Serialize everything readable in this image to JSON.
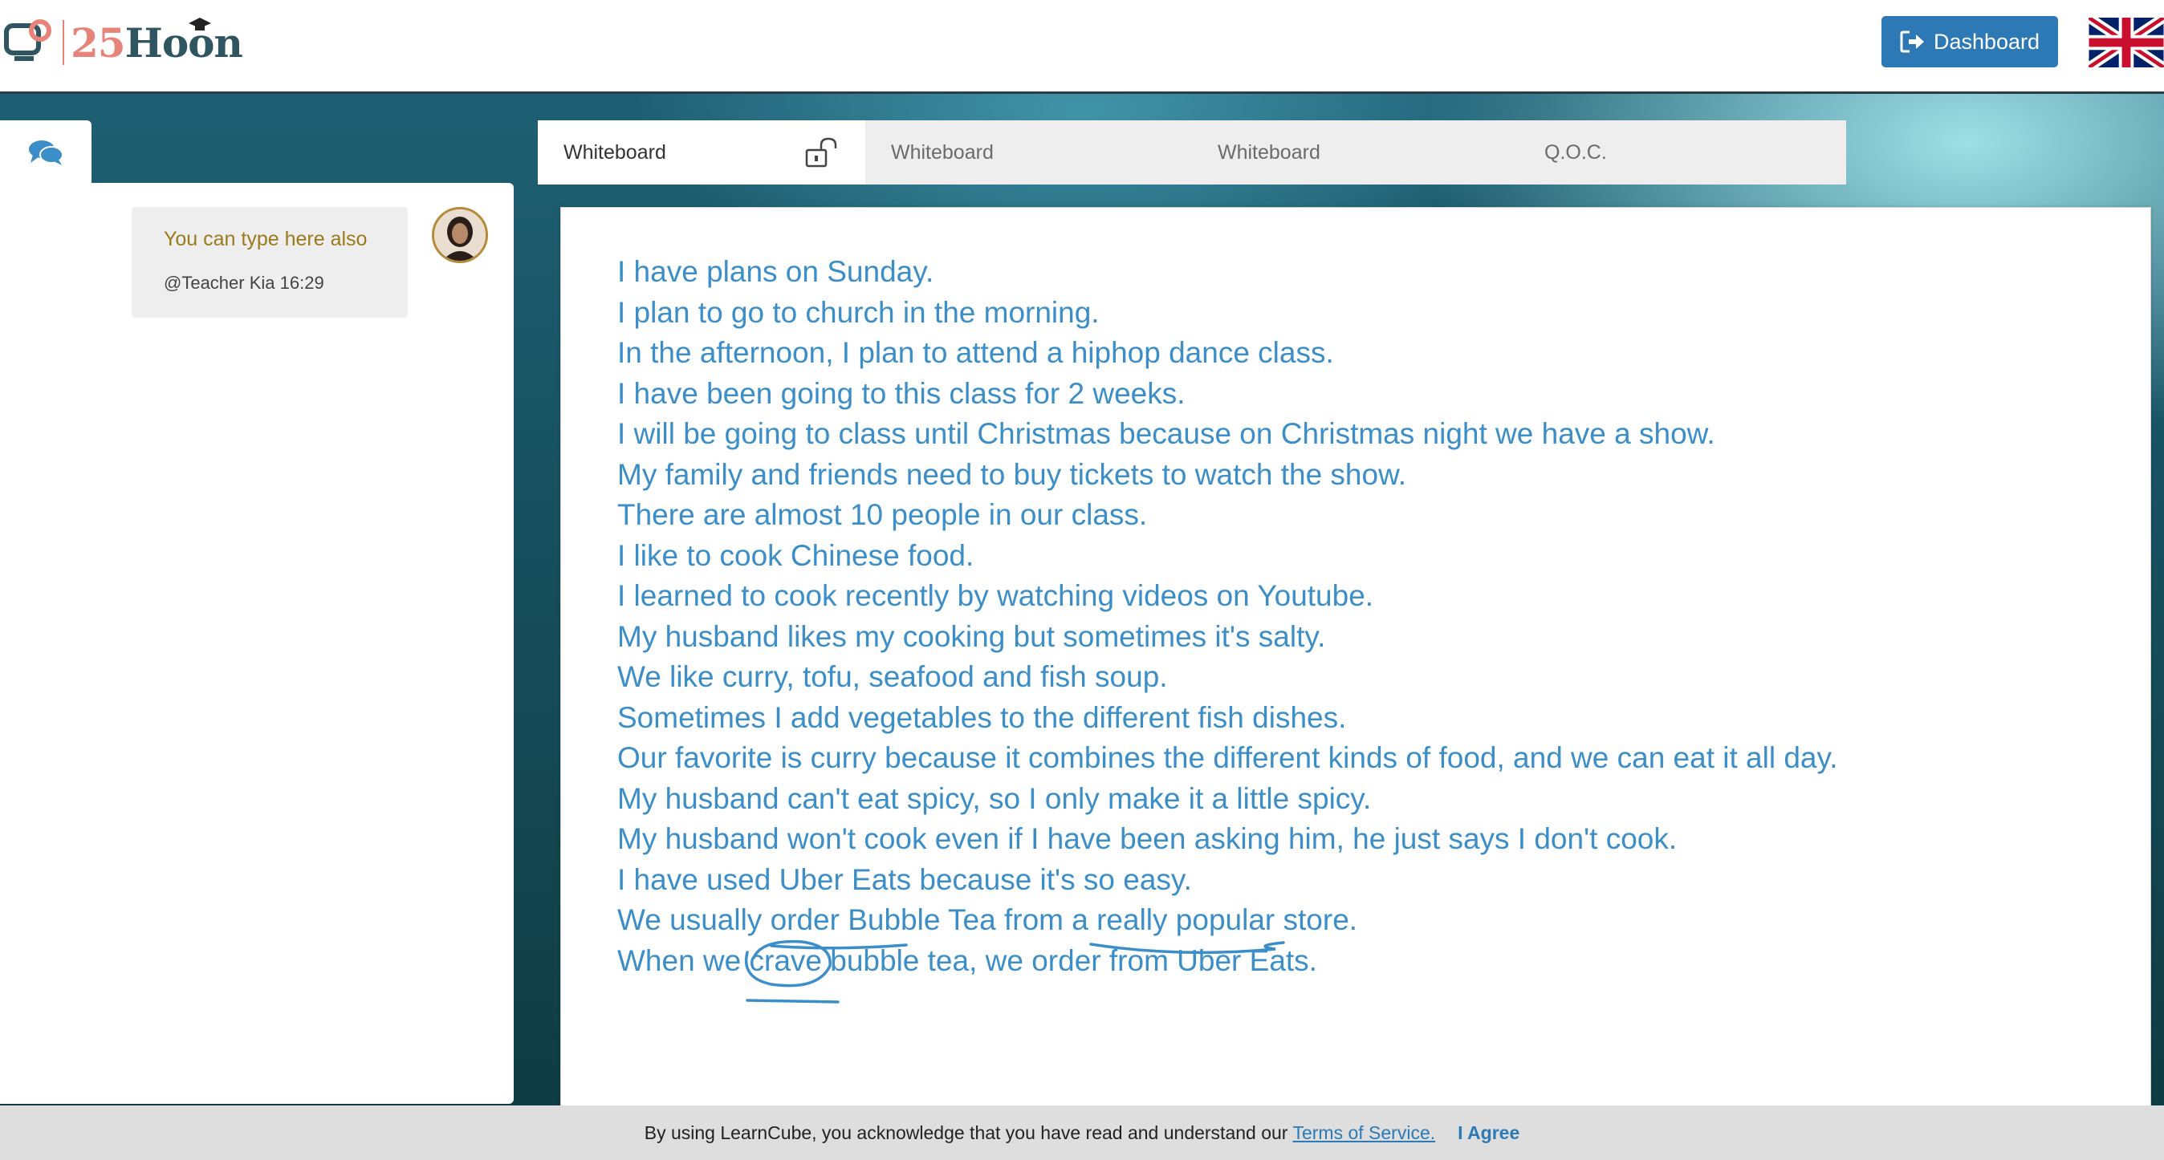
{
  "header": {
    "logo_number": "25",
    "logo_word": "Hoon",
    "dashboard_label": "Dashboard",
    "language": "English (UK flag)"
  },
  "chat": {
    "messages": [
      {
        "text": "You can type here also",
        "meta": "@Teacher Kia 16:29"
      }
    ]
  },
  "tabs": [
    {
      "label": "Whiteboard",
      "active": true,
      "locked": false
    },
    {
      "label": "Whiteboard",
      "active": false
    },
    {
      "label": "Whiteboard",
      "active": false
    },
    {
      "label": "Q.O.C.",
      "active": false
    }
  ],
  "whiteboard": {
    "ink_color": "#3b8ec8",
    "lines": [
      "I have plans on Sunday.",
      "I plan to go to church in the morning.",
      "In the afternoon, I plan to attend a hiphop dance class.",
      "I have been going to this class for 2 weeks.",
      "I will be going to class until Christmas because on Christmas night we have a show.",
      "My family and friends need to buy tickets to watch the show.",
      "There are almost 10 people in our class.",
      "I like to cook Chinese food.",
      "I learned to cook recently by watching videos on Youtube.",
      "My husband likes my cooking but sometimes it's salty.",
      "We like curry, tofu, seafood and fish soup.",
      "Sometimes I add vegetables to the different fish dishes.",
      "Our favorite is curry because it combines the different kinds of food, and we can eat it all day.",
      "My husband can't eat spicy, so I only make it a little spicy.",
      "My husband won't cook even if I have been asking him, he just says I don't cook.",
      "I have used Uber Eats because it's so easy.",
      "We usually order Bubble Tea from a really popular store.",
      "When we crave bubble tea, we order from Uber Eats."
    ]
  },
  "cookie_bar": {
    "text": "By using LearnCube, you acknowledge that you have read and understand our",
    "link": "Terms of Service.",
    "agree": "I Agree"
  },
  "colors": {
    "accent": "#2c79b6",
    "logo_coral": "#e8837a",
    "logo_teal": "#2e5560",
    "chat_text": "#9a7a1a"
  }
}
